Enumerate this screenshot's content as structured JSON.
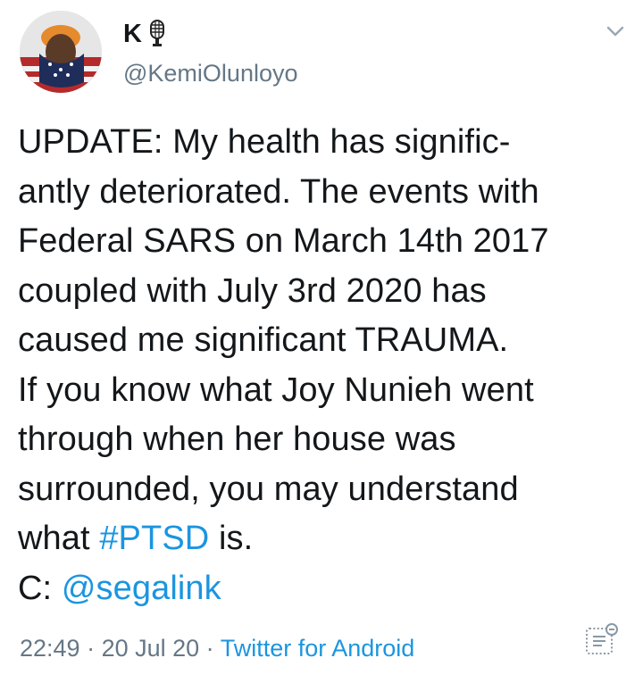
{
  "author": {
    "display_name": "K",
    "handle": "@KemiOlunloyo",
    "avatar": "avatar",
    "badge_icon": "microphone-icon"
  },
  "menu_icon": "chevron-down-icon",
  "body": {
    "line1": "UPDATE: My health has signific-",
    "line2": "antly deteriorated. The events with",
    "line3": "Federal SARS on March 14th 2017",
    "line4": "coupled with July 3rd 2020 has",
    "line5": "caused me significant TRAUMA.",
    "line6": "If you know what Joy Nunieh went",
    "line7": "through when her house was",
    "line8": "surrounded, you may understand",
    "line9_prefix": "what ",
    "hashtag": "#PTSD",
    "line9_suffix": " is.",
    "line10_prefix": "C: ",
    "mention": "@segalink"
  },
  "meta": {
    "time": "22:49",
    "separator1": " · ",
    "date": "20 Jul 20",
    "separator2": " · ",
    "source": "Twitter for Android"
  },
  "colors": {
    "text": "#14171a",
    "secondary": "#657786",
    "link": "#1b95e0"
  },
  "analytics_icon": "analytics-icon"
}
